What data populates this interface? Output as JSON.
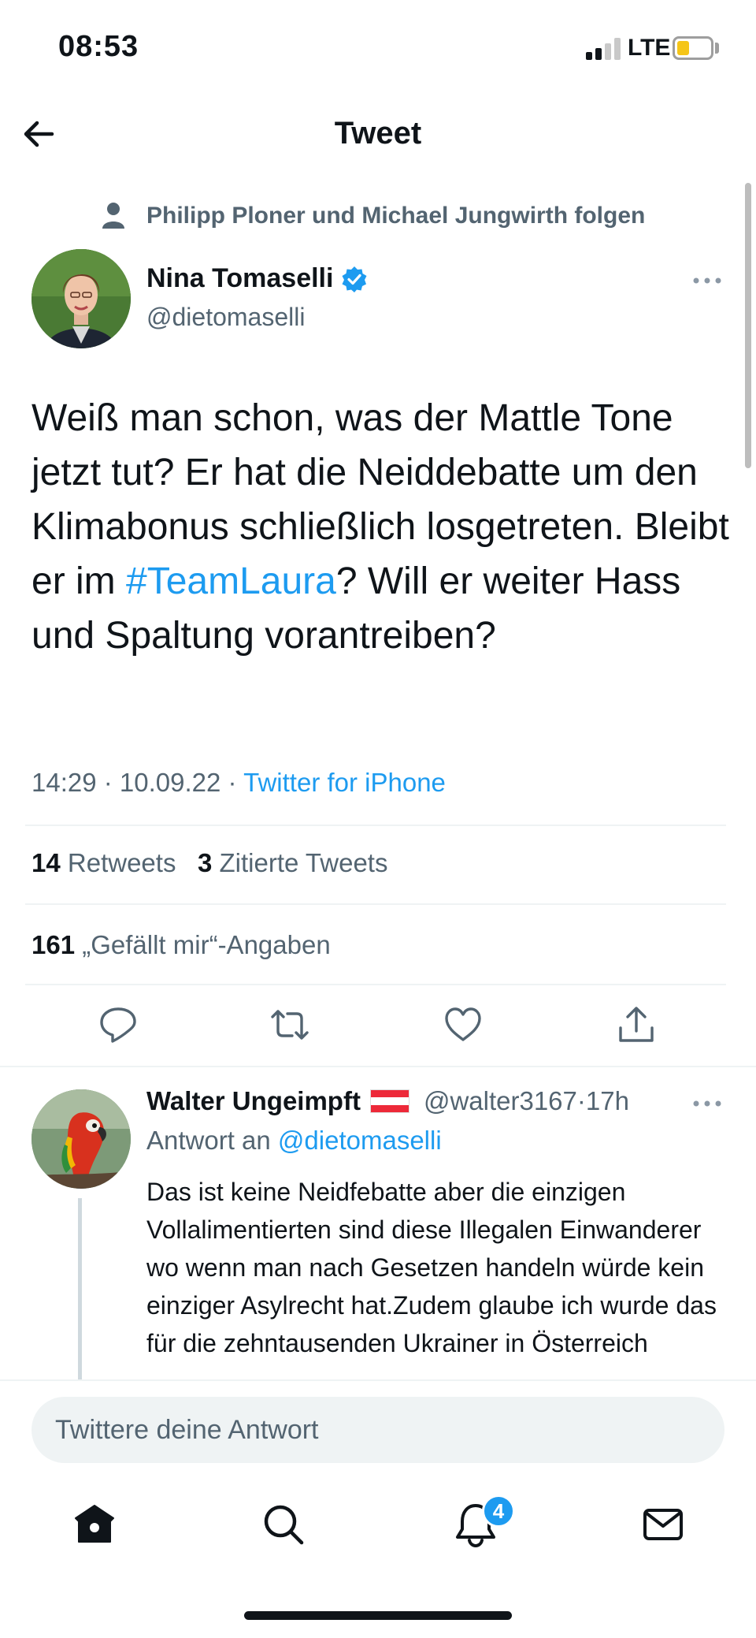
{
  "status_bar": {
    "time": "08:53",
    "network": "LTE"
  },
  "header": {
    "title": "Tweet",
    "back_icon": "arrow-left-icon"
  },
  "social_context": {
    "text": "Philipp Ploner und Michael Jungwirth folgen",
    "icon": "person-icon"
  },
  "tweet": {
    "author_name": "Nina Tomaselli",
    "author_handle": "@dietomaselli",
    "verified": true,
    "text_part1": "Weiß man schon, was der Mattle Tone jetzt tut? Er hat die Neiddebatte um den Klimabonus schließlich losgetreten. Bleibt er im ",
    "hashtag": "#TeamLaura",
    "text_part2": "? Will er weiter Hass und Spaltung vorantreiben?",
    "time": "14:29",
    "separator": " · ",
    "date": "10.09.22",
    "app": "Twitter for iPhone",
    "retweets_count": "14",
    "retweets_label": "Retweets",
    "quotes_count": "3",
    "quotes_label": "Zitierte Tweets",
    "likes_count": "161",
    "likes_label": "„Gefällt mir“-Angaben"
  },
  "reply": {
    "author_name": "Walter Ungeimpft",
    "flag": "austria-flag",
    "handle": "@walter3167",
    "time": "17h",
    "meta_sep": " · ",
    "reply_to_label": "Antwort an ",
    "reply_to_handle": "@dietomaselli",
    "text": "Das ist keine Neidfebatte  aber die einzigen Vollalimentierten sind diese Illegalen Einwanderer  wo  wenn man nach Gesetzen handeln würde kein einziger Asylrecht hat.Zudem glaube ich  wurde das für die zehntausenden Ukrainer in Österreich"
  },
  "compose": {
    "placeholder": "Twittere deine Antwort"
  },
  "bottom_nav": {
    "notification_badge": "4"
  },
  "colors": {
    "accent": "#1d9bf0",
    "secondary_text": "#536471",
    "primary_text": "#0f1419",
    "divider": "#eff3f4"
  }
}
